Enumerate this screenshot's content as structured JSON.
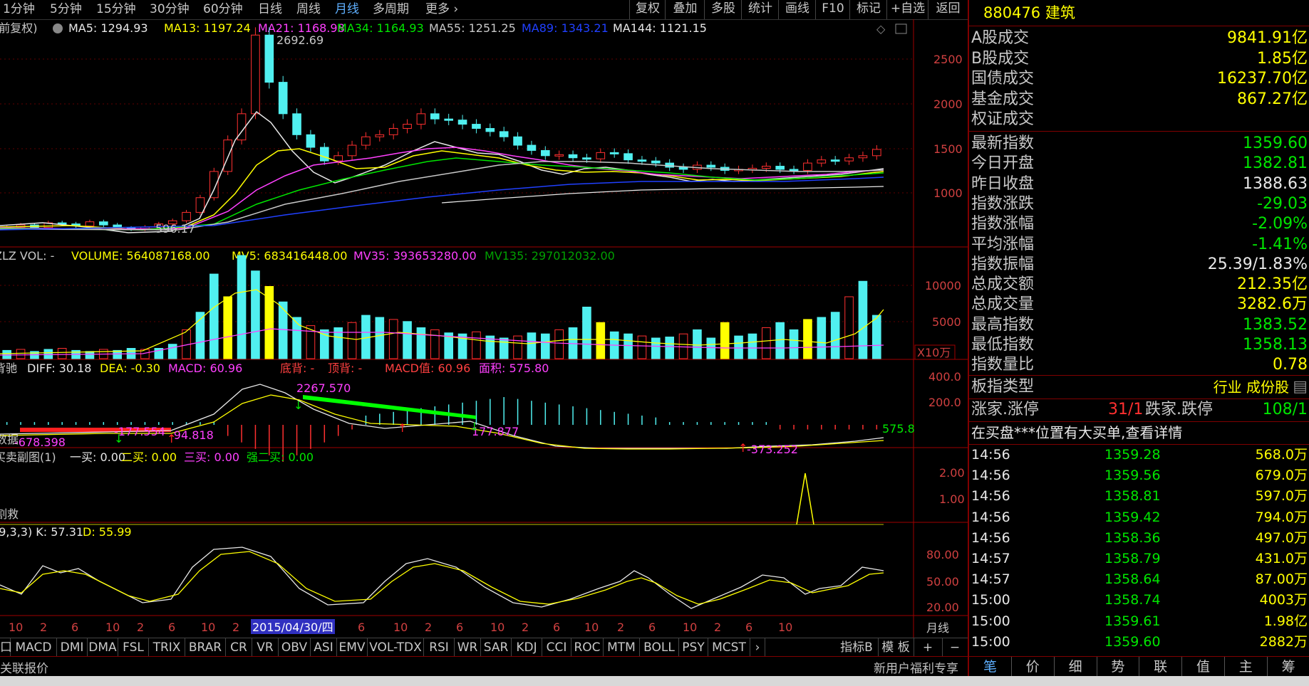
{
  "toolbar": {
    "periods": [
      "1分钟",
      "5分钟",
      "15分钟",
      "30分钟",
      "60分钟",
      "日线",
      "周线",
      "月线",
      "多周期",
      "更多"
    ],
    "active_period": "月线",
    "more_icon": "chevron-right-icon",
    "actions": [
      "复权",
      "叠加",
      "多股",
      "统计",
      "画线",
      "F10",
      "标记",
      "+自选",
      "返回"
    ]
  },
  "main_legend": {
    "prefix": "(前复权)",
    "items": [
      {
        "label": "MA5: 1294.93",
        "color": "#e8e8e8"
      },
      {
        "label": "MA13: 1197.24",
        "color": "#ffff00"
      },
      {
        "label": "MA21: 1168.98",
        "color": "#ff40ff"
      },
      {
        "label": "MA34: 1164.93",
        "color": "#00e600"
      },
      {
        "label": "MA55: 1251.25",
        "color": "#c8c8c8"
      },
      {
        "label": "MA89: 1343.21",
        "color": "#2040ff"
      },
      {
        "label": "MA144: 1121.15",
        "color": "#e8e8e8"
      }
    ],
    "high_label": "2692.69",
    "low_label": "596.17",
    "yticks": [
      "2500",
      "2000",
      "1500",
      "1000"
    ]
  },
  "vol_legend": {
    "items": [
      {
        "label": "ZLZ VOL: -",
        "color": "#c8c8c8"
      },
      {
        "label": "VOLUME: 564087168.00",
        "color": "#ffff00"
      },
      {
        "label": "MV5: 683416448.00",
        "color": "#ffff00"
      },
      {
        "label": "MV35: 393653280.00",
        "color": "#ff40ff"
      },
      {
        "label": "MV135: 297012032.00",
        "color": "#00a000"
      }
    ],
    "yticks": [
      "10000",
      "5000"
    ],
    "unit": "X10万"
  },
  "macd_legend": {
    "items": [
      {
        "label": "背驰",
        "color": "#c8c8c8"
      },
      {
        "label": "DIFF: 30.18",
        "color": "#e8e8e8"
      },
      {
        "label": "DEA: -0.30",
        "color": "#ffff00"
      },
      {
        "label": "MACD: 60.96",
        "color": "#ff40ff"
      },
      {
        "label": "底背: -",
        "color": "#ff4040"
      },
      {
        "label": "顶背: -",
        "color": "#ff4040"
      },
      {
        "label": "MACD值: 60.96",
        "color": "#ff4040"
      },
      {
        "label": "面积: 575.80",
        "color": "#ff40ff"
      }
    ],
    "yticks": [
      "400.0",
      "200.0"
    ],
    "annotations": [
      "2267.570",
      "-678.398",
      "-177.554",
      "-94.818",
      "177.877",
      "-373.252",
      "575.8"
    ],
    "left_text": "数据"
  },
  "bs_legend": {
    "items": [
      {
        "label": "买卖副图(1)",
        "color": "#c8c8c8"
      },
      {
        "label": "一买: 0.00",
        "color": "#e8e8e8"
      },
      {
        "label": "二买: 0.00",
        "color": "#ffff00"
      },
      {
        "label": "三买: 0.00",
        "color": "#ff40ff"
      },
      {
        "label": "强二买: 0.00",
        "color": "#00e600"
      }
    ],
    "yticks": [
      "2.00",
      "1.00"
    ],
    "left_text": "割救"
  },
  "kdj_legend": {
    "items": [
      {
        "label": "(9,3,3) K: 57.31",
        "color": "#e8e8e8"
      },
      {
        "label": "D: 55.99",
        "color": "#ffff00"
      }
    ],
    "yticks": [
      "80.00",
      "50.00",
      "20.00"
    ]
  },
  "time_axis": {
    "labels": [
      "10",
      "2",
      "6",
      "10",
      "2",
      "6",
      "10",
      "2",
      "2015/04/30/四",
      "6",
      "10",
      "2",
      "6",
      "10",
      "2",
      "6",
      "10",
      "2",
      "6",
      "10",
      "2",
      "6",
      "10"
    ],
    "period": "月线"
  },
  "indicators": [
    "口",
    "MACD",
    "DMI",
    "DMA",
    "FSL",
    "TRIX",
    "BRAR",
    "CR",
    "VR",
    "OBV",
    "ASI",
    "EMV",
    "VOL-TDX",
    "RSI",
    "WR",
    "SAR",
    "KDJ",
    "CCI",
    "ROC",
    "MTM",
    "BOLL",
    "PSY",
    "MCST"
  ],
  "indicator_right": [
    "指标B",
    "模 板",
    "+",
    "−"
  ],
  "status_left": "关联报价",
  "status_right": "新用户福利专享",
  "right_panel": {
    "title": "880476 建筑",
    "turnover": [
      {
        "label": "A股成交",
        "value": "9841.91亿",
        "color": "#ffff00"
      },
      {
        "label": "B股成交",
        "value": "1.85亿",
        "color": "#ffff00"
      },
      {
        "label": "国债成交",
        "value": "16237.70亿",
        "color": "#ffff00"
      },
      {
        "label": "基金成交",
        "value": "867.27亿",
        "color": "#ffff00"
      },
      {
        "label": "权证成交",
        "value": "",
        "color": "#ffff00"
      }
    ],
    "stats": [
      {
        "label": "最新指数",
        "value": "1359.60",
        "color": "#00e600"
      },
      {
        "label": "今日开盘",
        "value": "1382.81",
        "color": "#00e600"
      },
      {
        "label": "昨日收盘",
        "value": "1388.63",
        "color": "#e8e8e8"
      },
      {
        "label": "指数涨跌",
        "value": "-29.03",
        "color": "#00e600"
      },
      {
        "label": "指数涨幅",
        "value": "-2.09%",
        "color": "#00e600"
      },
      {
        "label": "平均涨幅",
        "value": "-1.41%",
        "color": "#00e600"
      },
      {
        "label": "指数振幅",
        "value": "25.39/1.83%",
        "color": "#e8e8e8"
      },
      {
        "label": "总成交额",
        "value": "212.35亿",
        "color": "#ffff00"
      },
      {
        "label": "总成交量",
        "value": "3282.6万",
        "color": "#ffff00"
      },
      {
        "label": "最高指数",
        "value": "1383.52",
        "color": "#00e600"
      },
      {
        "label": "最低指数",
        "value": "1358.13",
        "color": "#00e600"
      },
      {
        "label": "指数量比",
        "value": "0.78",
        "color": "#ffff00"
      }
    ],
    "type_label": "板指类型",
    "type_value": "行业 成份股",
    "rise_label": "涨家.涨停",
    "rise_value": "31/1",
    "fall_label": "跌家.跌停",
    "fall_value": "108/1",
    "notice": "在买盘***位置有大买单,查看详情",
    "ticks": [
      {
        "t": "14:56",
        "p": "1359.28",
        "v": "568.0万"
      },
      {
        "t": "14:56",
        "p": "1359.56",
        "v": "679.0万"
      },
      {
        "t": "14:56",
        "p": "1358.81",
        "v": "597.0万"
      },
      {
        "t": "14:56",
        "p": "1359.42",
        "v": "794.0万"
      },
      {
        "t": "14:56",
        "p": "1358.36",
        "v": "497.0万"
      },
      {
        "t": "14:57",
        "p": "1358.79",
        "v": "431.0万"
      },
      {
        "t": "14:57",
        "p": "1358.64",
        "v": "87.00万"
      },
      {
        "t": "15:00",
        "p": "1358.74",
        "v": "4003万"
      },
      {
        "t": "15:00",
        "p": "1359.61",
        "v": "1.98亿"
      },
      {
        "t": "15:00",
        "p": "1359.60",
        "v": "2882万"
      }
    ],
    "tabs": [
      "笔",
      "价",
      "细",
      "势",
      "联",
      "值",
      "主",
      "筹"
    ],
    "active_tab": "笔"
  },
  "chart_data": {
    "type": "candlestick",
    "period": "monthly",
    "high": 2692.69,
    "low": 596.17,
    "ylim": [
      500,
      2800
    ],
    "closes": [
      620,
      640,
      615,
      660,
      650,
      630,
      670,
      640,
      610,
      600,
      620,
      650,
      680,
      760,
      900,
      1150,
      1450,
      1700,
      2450,
      2000,
      1700,
      1500,
      1380,
      1250,
      1300,
      1400,
      1480,
      1500,
      1560,
      1600,
      1700,
      1650,
      1640,
      1600,
      1560,
      1530,
      1480,
      1400,
      1350,
      1300,
      1310,
      1280,
      1270,
      1330,
      1320,
      1260,
      1250,
      1230,
      1190,
      1170,
      1210,
      1190,
      1160,
      1170,
      1180,
      1200,
      1170,
      1160,
      1230,
      1260,
      1250,
      1280,
      1300,
      1360
    ]
  }
}
